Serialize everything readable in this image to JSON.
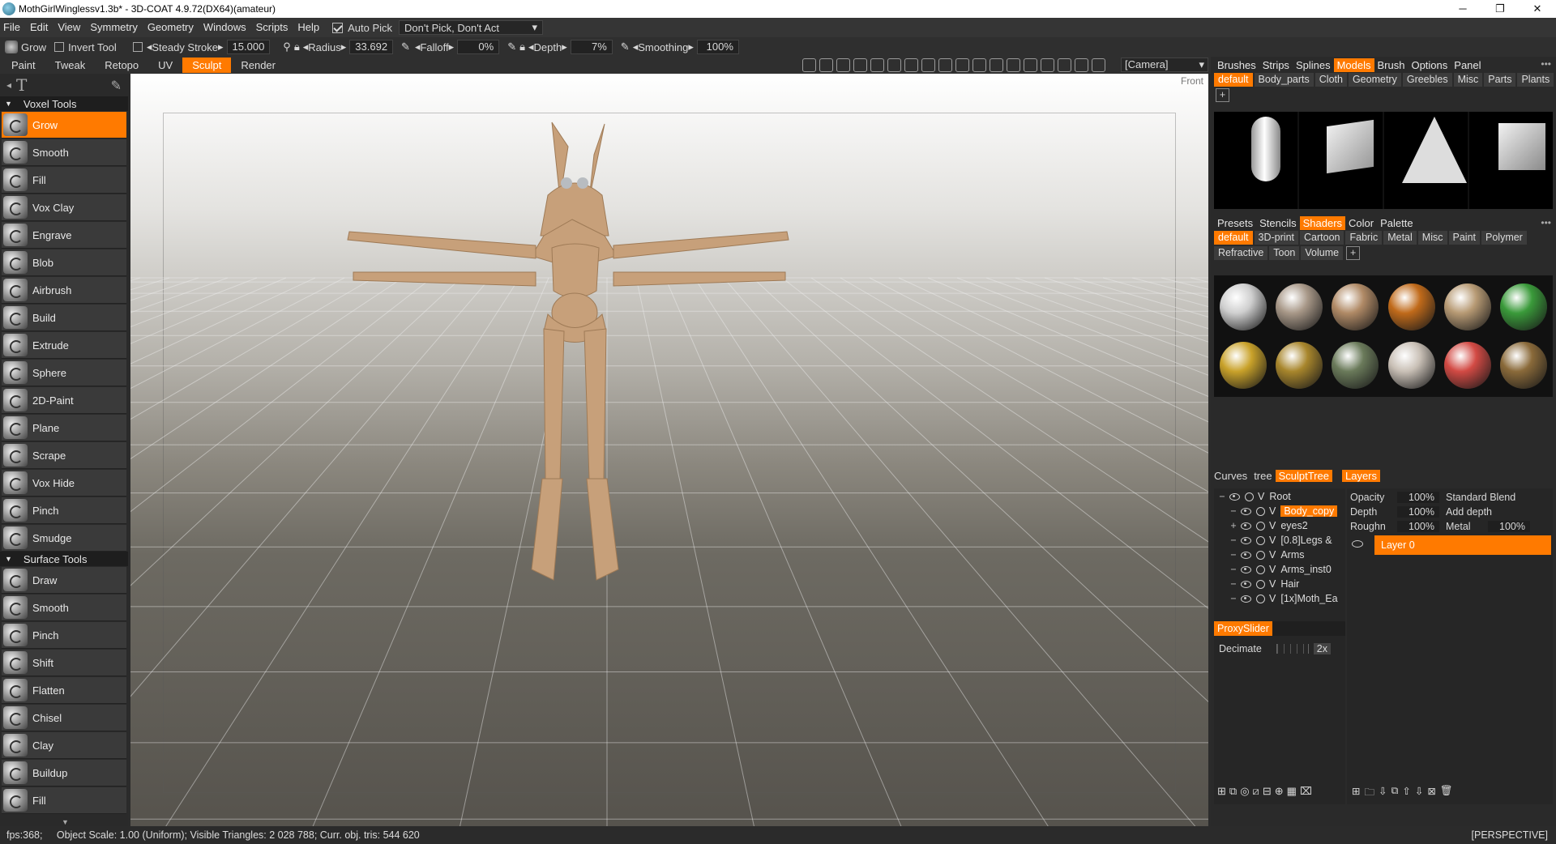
{
  "window": {
    "title": "MothGirlWinglessv1.3b* - 3D-COAT 4.9.72(DX64)(amateur)",
    "minimize": "─",
    "maximize": "❐",
    "close": "✕"
  },
  "menu": {
    "items": [
      "File",
      "Edit",
      "View",
      "Symmetry",
      "Geometry",
      "Windows",
      "Scripts",
      "Help"
    ],
    "autopick_label": "Auto Pick",
    "pick_mode": "Don't Pick, Don't Act"
  },
  "options": {
    "tool_label": "Grow",
    "invert_label": "Invert Tool",
    "steady_label": "Steady Stroke",
    "steady_value": "15.000",
    "radius_label": "Radius",
    "radius_value": "33.692",
    "falloff_label": "Falloff",
    "falloff_value": "0%",
    "depth_label": "Depth",
    "depth_value": "7%",
    "smoothing_label": "Smoothing",
    "smoothing_value": "100%"
  },
  "rooms": {
    "tabs": [
      "Paint",
      "Tweak",
      "Retopo",
      "UV",
      "Sculpt",
      "Render"
    ],
    "active": "Sculpt",
    "camera": "[Camera]"
  },
  "left": {
    "voxel_section": "Voxel Tools",
    "voxel_tools": [
      "Grow",
      "Smooth",
      "Fill",
      "Vox Clay",
      "Engrave",
      "Blob",
      "Airbrush",
      "Build",
      "Extrude",
      "Sphere",
      "2D-Paint",
      "Plane",
      "Scrape",
      "Vox Hide",
      "Pinch",
      "Smudge"
    ],
    "surface_section": "Surface Tools",
    "surface_tools": [
      "Draw",
      "Smooth",
      "Pinch",
      "Shift",
      "Flatten",
      "Chisel",
      "Clay",
      "Buildup",
      "Fill"
    ],
    "active_tool": "Grow"
  },
  "viewport": {
    "view_label": "Front",
    "model_color": "#c7a07a"
  },
  "right": {
    "top_tabs": [
      "Brushes",
      "Strips",
      "Splines",
      "Models",
      "Brush",
      "Options",
      "Panel"
    ],
    "top_active": "Models",
    "model_cats": [
      "default",
      "Body_parts",
      "Cloth",
      "Geometry",
      "Greebles",
      "Misc",
      "Parts",
      "Plants"
    ],
    "model_active": "default",
    "mid_tabs": [
      "Presets",
      "Stencils",
      "Shaders",
      "Color",
      "Palette"
    ],
    "mid_active": "Shaders",
    "shader_cats": [
      "default",
      "3D-print",
      "Cartoon",
      "Fabric",
      "Metal",
      "Misc",
      "Paint",
      "Polymer",
      "Refractive",
      "Toon",
      "Volume"
    ],
    "shader_active": "default",
    "shader_colors": [
      "#cfcfcf",
      "#a89888",
      "#b08a66",
      "#c06a1a",
      "#b79a74",
      "#3a9a3a",
      "#c9a22a",
      "#a8862c",
      "#6a7a5a",
      "#c9c0b6",
      "#d24a44",
      "#8a6a3a"
    ],
    "tree_tabs": [
      "Curves",
      "tree",
      "SculptTree"
    ],
    "tree_active": "SculptTree",
    "layers_tab": "Layers",
    "tree_nodes": [
      {
        "pm": "−",
        "name": "Root",
        "indent": 0,
        "selected": false
      },
      {
        "pm": "−",
        "name": "Body_copy",
        "indent": 1,
        "selected": true
      },
      {
        "pm": "+",
        "name": "eyes2",
        "indent": 1,
        "selected": false
      },
      {
        "pm": "−",
        "name": "[0.8]Legs &",
        "indent": 1,
        "selected": false
      },
      {
        "pm": "−",
        "name": "Arms",
        "indent": 1,
        "selected": false
      },
      {
        "pm": "−",
        "name": "Arms_inst0",
        "indent": 1,
        "selected": false
      },
      {
        "pm": "−",
        "name": "Hair",
        "indent": 1,
        "selected": false
      },
      {
        "pm": "−",
        "name": "[1x]Moth_Ea",
        "indent": 1,
        "selected": false
      }
    ],
    "layers": {
      "opacity_label": "Opacity",
      "opacity_value": "100%",
      "blend": "Standard Blend",
      "depth_label": "Depth",
      "depth_value": "100%",
      "depth_mode": "Add depth",
      "rough_label": "Roughn",
      "rough_value": "100%",
      "metal_label": "Metal",
      "metal_value": "100%",
      "layer_name": "Layer 0"
    },
    "proxy_tab": "ProxySlider",
    "decimate_label": "Decimate",
    "decimate_value": "2x"
  },
  "status": {
    "text": "fps:368;     Object Scale: 1.00 (Uniform); Visible Triangles: 2 028 788; Curr. obj. tris: 544 620",
    "projection": "[PERSPECTIVE]"
  }
}
